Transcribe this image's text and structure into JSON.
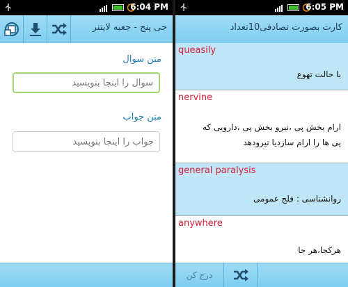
{
  "left_screen": {
    "status_time": "6:04 PM",
    "title": "جی پنج - جعبه لایتنر",
    "question_label": "متن سوال",
    "question_placeholder": "سوال را اینجا بنویسید",
    "answer_label": "متن جواب",
    "answer_placeholder": "جواب را اینجا بنویسید",
    "toolbar_icons": [
      "lightbox-settings-icon",
      "download-icon",
      "shuffle-icon"
    ]
  },
  "right_screen": {
    "status_time": "6:05 PM",
    "title": "کارت بصورت تصادفی10تعداد",
    "cards": [
      {
        "word": "queasily",
        "meaning": "با حالت تهوع"
      },
      {
        "word": "nervine",
        "meaning": "ارام بخش پی ،نیرو بخش پی ،دارویی که پی ها را ارام سازدیا نیرودهد"
      },
      {
        "word": "general paralysis",
        "meaning": "روانشناسی : فلج عمومی"
      },
      {
        "word": "anywhere",
        "meaning": "هرکجا،هر جا"
      }
    ],
    "bottom_insert_label": "درج کن",
    "colors": {
      "card_even": "#bfe6f7",
      "card_odd": "#ffffff",
      "word": "#d9203a"
    }
  }
}
